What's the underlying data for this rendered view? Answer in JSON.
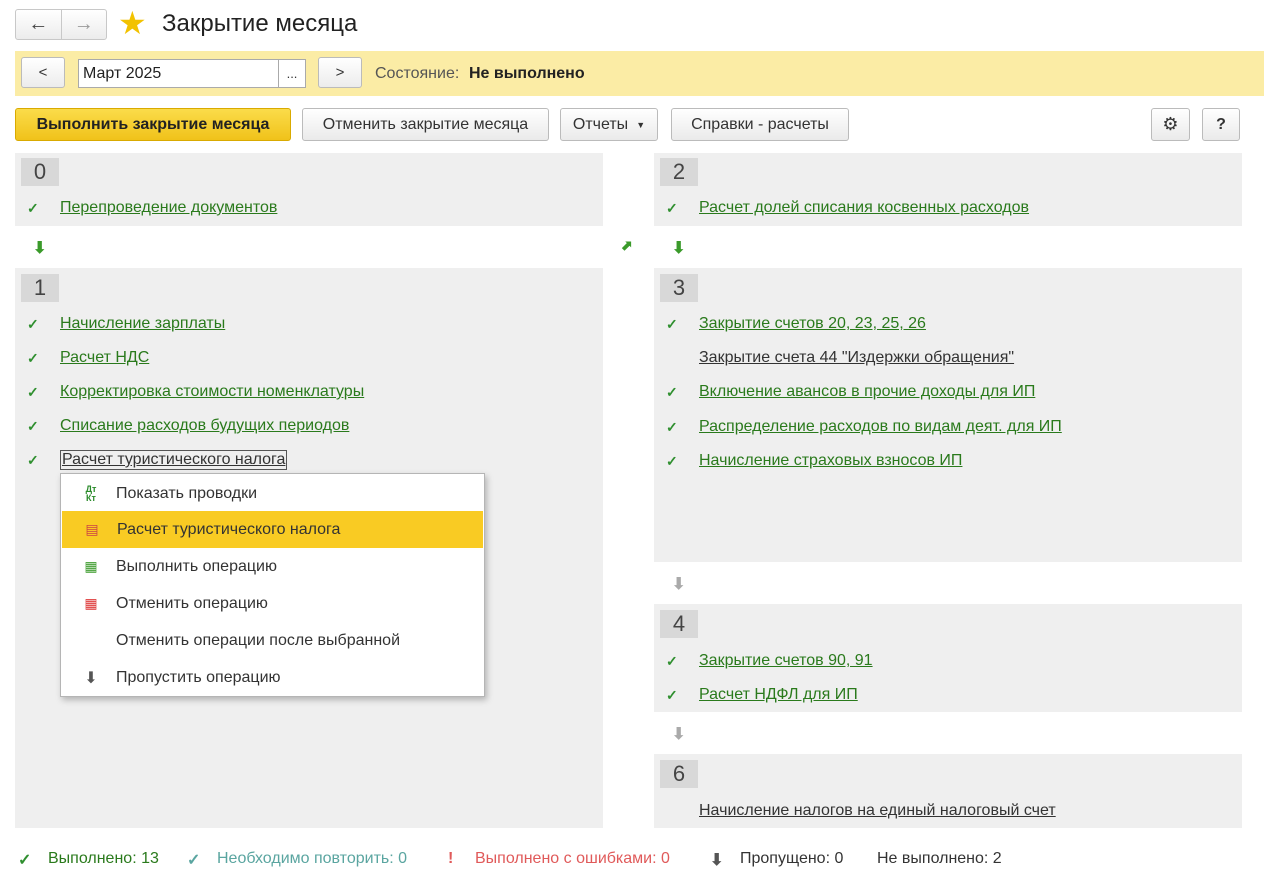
{
  "header": {
    "title": "Закрытие месяца",
    "back_icon": "←",
    "forward_icon": "→",
    "star_icon": "★"
  },
  "period": {
    "prev": "<",
    "value": "Март 2025",
    "select": "...",
    "next": ">",
    "status_label": "Состояние:",
    "status_value": "Не выполнено"
  },
  "toolbar": {
    "execute": "Выполнить закрытие месяца",
    "cancel": "Отменить закрытие месяца",
    "reports": "Отчеты",
    "references": "Справки - расчеты",
    "settings_icon": "⚙",
    "help": "?"
  },
  "steps": {
    "s0": {
      "num": "0",
      "items": [
        "Перепроведение документов"
      ]
    },
    "s1": {
      "num": "1",
      "items": [
        "Начисление зарплаты",
        "Расчет НДС",
        "Корректировка стоимости номенклатуры",
        "Списание расходов будущих периодов",
        "Расчет туристического налога"
      ]
    },
    "s2": {
      "num": "2",
      "items": [
        "Расчет долей списания косвенных расходов"
      ]
    },
    "s3": {
      "num": "3",
      "items": [
        "Закрытие счетов 20, 23, 25, 26",
        "Закрытие счета 44 \"Издержки обращения\"",
        "Включение авансов в прочие доходы для ИП",
        "Распределение расходов по видам деят. для ИП",
        "Начисление страховых взносов ИП"
      ]
    },
    "s4": {
      "num": "4",
      "items": [
        "Закрытие счетов 90, 91",
        "Расчет НДФЛ для ИП"
      ]
    },
    "s6": {
      "num": "6",
      "items": [
        "Начисление налогов на единый налоговый счет"
      ]
    }
  },
  "menu": {
    "items": [
      "Показать проводки",
      "Расчет туристического налога",
      "Выполнить операцию",
      "Отменить операцию",
      "Отменить операции после выбранной",
      "Пропустить операцию"
    ],
    "dtkt_icon": "Дт Кт"
  },
  "footer": {
    "done": "Выполнено: 13",
    "repeat": "Необходимо повторить: 0",
    "errors": "Выполнено с ошибками: 0",
    "skipped": "Пропущено: 0",
    "not_done": "Не выполнено: 2"
  },
  "colors": {
    "accent": "#f9cb23",
    "done": "#2a7a1c",
    "repeat": "#5aa5a0",
    "error": "#e05a5a",
    "status_bar": "#fbeca5"
  }
}
